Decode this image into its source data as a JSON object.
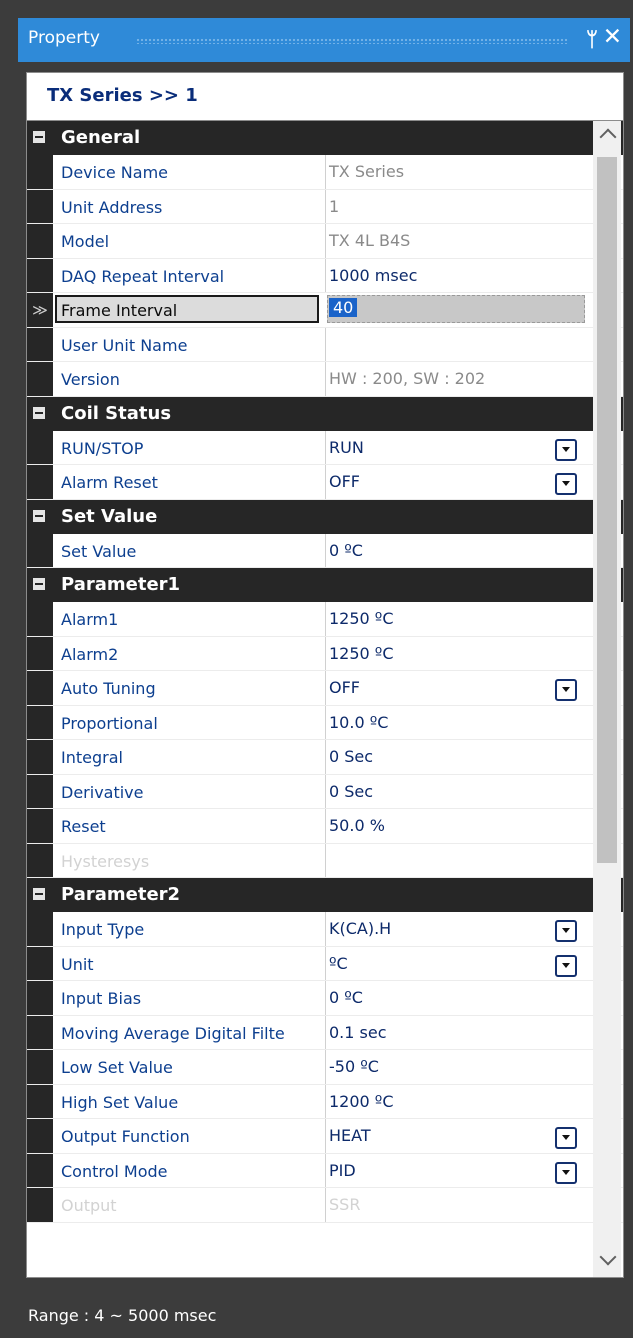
{
  "window": {
    "title": "Property",
    "pin_icon": "pin-icon",
    "close_icon": "close-icon"
  },
  "object_selector": "TX Series >> 1",
  "categories": {
    "general": {
      "name": "General",
      "rows": {
        "device_name": {
          "label": "Device Name",
          "value": "TX Series"
        },
        "unit_address": {
          "label": "Unit Address",
          "value": "1"
        },
        "model": {
          "label": "Model",
          "value": "TX 4L B4S"
        },
        "daq_repeat": {
          "label": "DAQ Repeat Interval",
          "value": "1000 msec"
        },
        "frame_interval": {
          "label": "Frame Interval",
          "value": "40"
        },
        "user_unit_name": {
          "label": "User Unit Name",
          "value": ""
        },
        "version": {
          "label": "Version",
          "value": "HW : 200, SW : 202"
        }
      }
    },
    "coil_status": {
      "name": "Coil Status",
      "rows": {
        "run_stop": {
          "label": "RUN/STOP",
          "value": "RUN"
        },
        "alarm_reset": {
          "label": "Alarm Reset",
          "value": "OFF"
        }
      }
    },
    "set_value": {
      "name": "Set Value",
      "rows": {
        "set_value": {
          "label": "Set Value",
          "value": "0 ºC"
        }
      }
    },
    "parameter1": {
      "name": "Parameter1",
      "rows": {
        "alarm1": {
          "label": "Alarm1",
          "value": "1250 ºC"
        },
        "alarm2": {
          "label": "Alarm2",
          "value": "1250 ºC"
        },
        "auto_tuning": {
          "label": "Auto Tuning",
          "value": "OFF"
        },
        "proportional": {
          "label": "Proportional",
          "value": "10.0 ºC"
        },
        "integral": {
          "label": "Integral",
          "value": "0 Sec"
        },
        "derivative": {
          "label": "Derivative",
          "value": "0 Sec"
        },
        "reset": {
          "label": "Reset",
          "value": "50.0 %"
        },
        "hysteresys": {
          "label": "Hysteresys",
          "value": ""
        }
      }
    },
    "parameter2": {
      "name": "Parameter2",
      "rows": {
        "input_type": {
          "label": "Input Type",
          "value": "K(CA).H"
        },
        "unit": {
          "label": "Unit",
          "value": "ºC"
        },
        "input_bias": {
          "label": "Input Bias",
          "value": "0 ºC"
        },
        "moving_avg": {
          "label": "Moving Average Digital Filte",
          "value": "0.1 sec"
        },
        "low_set": {
          "label": "Low Set Value",
          "value": "-50 ºC"
        },
        "high_set": {
          "label": "High Set Value",
          "value": "1200 ºC"
        },
        "output_function": {
          "label": "Output Function",
          "value": "HEAT"
        },
        "control_mode": {
          "label": "Control Mode",
          "value": "PID"
        },
        "output": {
          "label": "Output",
          "value": "SSR"
        }
      }
    }
  },
  "selected_row_marker": "≫",
  "status": "Range : 4 ~ 5000 msec",
  "colors": {
    "title_bar": "#2f8ad8",
    "category_header": "#262626",
    "property_label": "#0d3f8f",
    "selection": "#1a63c9"
  }
}
